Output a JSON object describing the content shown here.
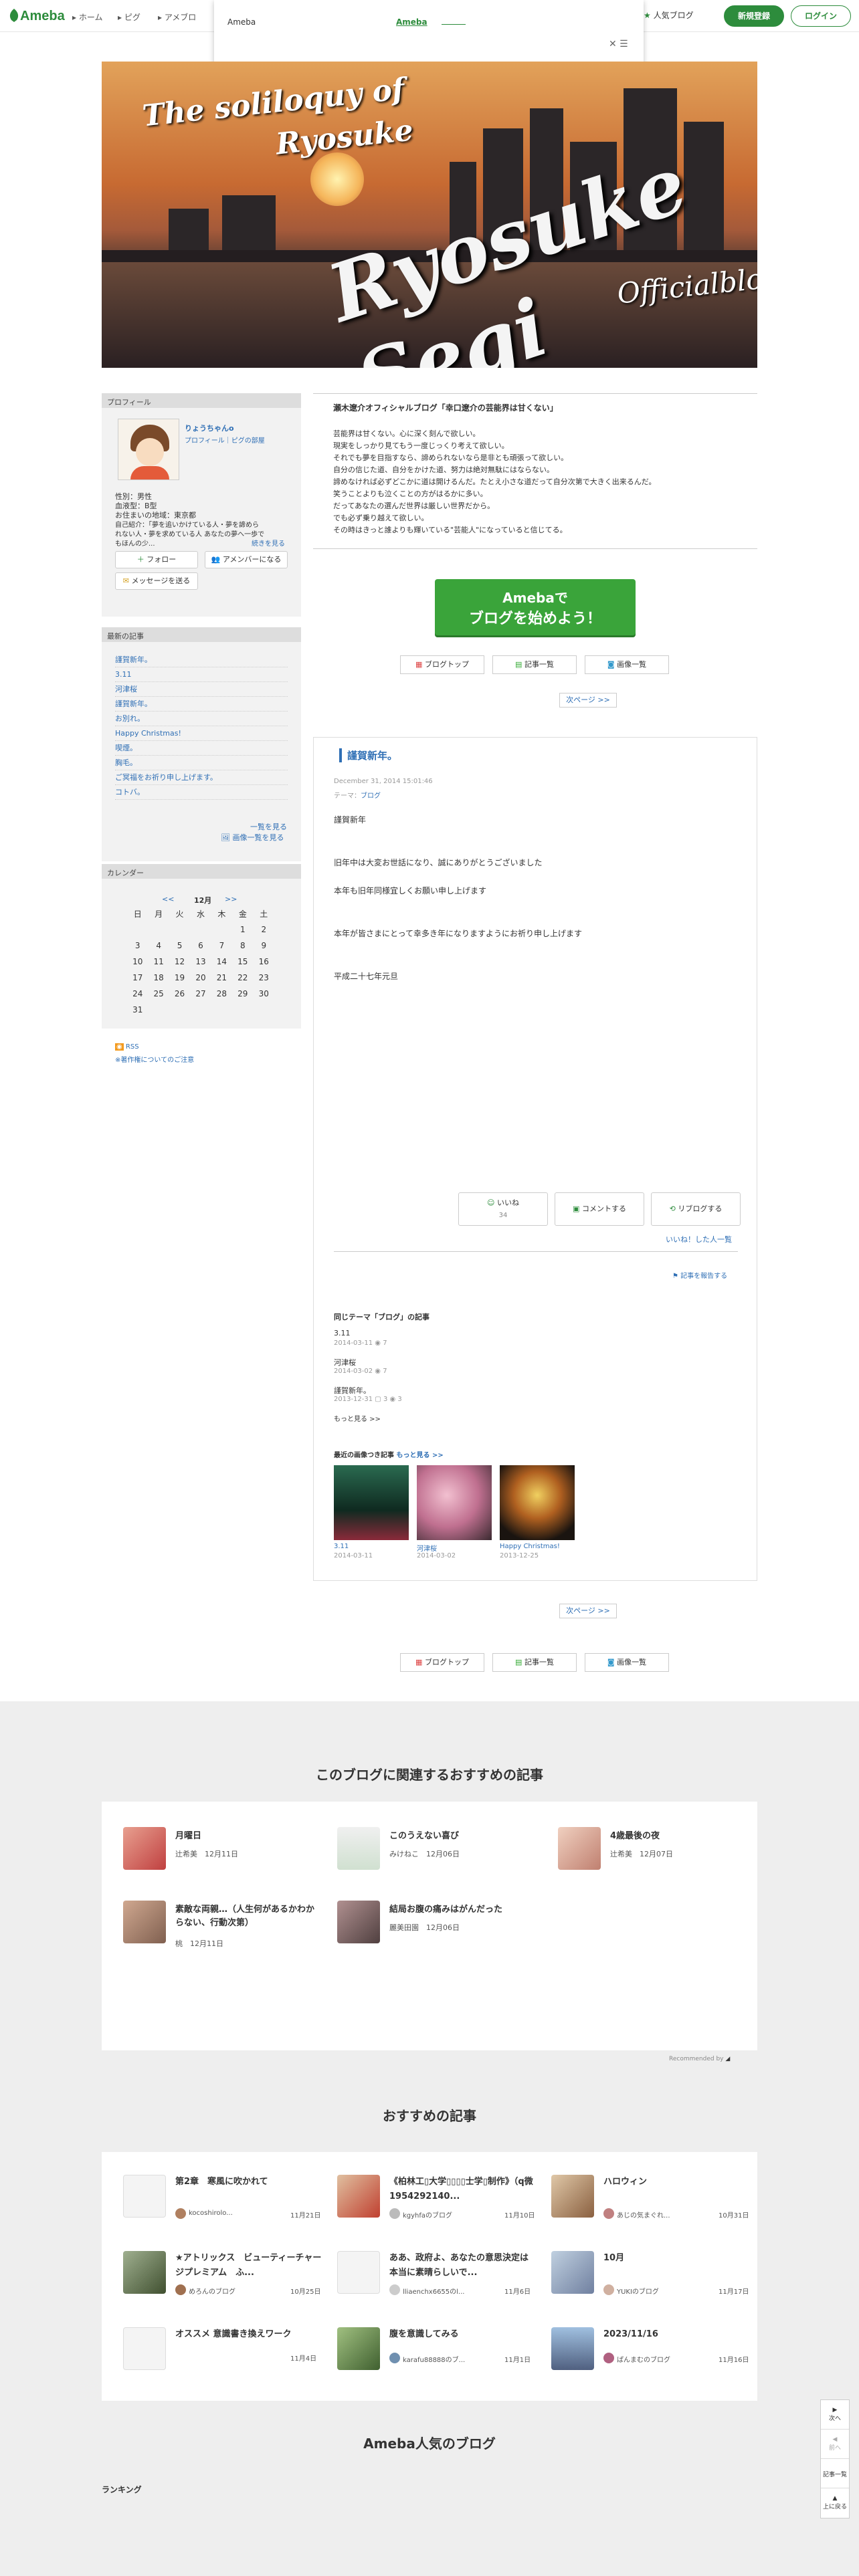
{
  "header": {
    "logo": "Ameba",
    "nav": [
      "ホーム",
      "ピグ",
      "アメブロ"
    ],
    "popup_title": "Ameba",
    "popup_link": "Ameba",
    "popular": "人気ブログ",
    "signup": "新規登録",
    "login": "ログイン"
  },
  "banner": {
    "line1": "The soliloquy of",
    "line2": "Ryosuke",
    "line3": "Ryosuke Segi",
    "line4": "Officialblog"
  },
  "profile": {
    "heading": "プロフィール",
    "name": "りょうちゃんo",
    "links": "プロフィール｜ピグの部屋",
    "gender": "性別：男性",
    "blood": "血液型：B型",
    "home": "お住まいの地域：東京都",
    "bio1": "自己紹介：「夢を追いかけている人・夢を諦めら",
    "bio2": "れない人・夢を求めている人 あなたの夢へ一歩で",
    "bio3": "もほんの少...",
    "more": "続きを見る",
    "follow": "フォロー",
    "member": "アメンバーになる",
    "message": "メッセージを送る"
  },
  "recent": {
    "heading": "最新の記事",
    "items": [
      "謹賀新年。",
      "3.11",
      "河津桜",
      "謹賀新年。",
      "お別れ。",
      "Happy Christmas!",
      "喫煙。",
      "胸毛。",
      "ご冥福をお祈り申し上げます。",
      "コトバ。"
    ],
    "list_link": "一覧を見る",
    "image_link": "画像一覧を見る"
  },
  "calendar": {
    "heading": "カレンダー",
    "prev": "<<",
    "month": "12月",
    "next": ">>",
    "weekdays": [
      "日",
      "月",
      "火",
      "水",
      "木",
      "金",
      "土"
    ],
    "rows": [
      [
        "",
        "",
        "",
        "",
        "",
        "1",
        "2"
      ],
      [
        "3",
        "4",
        "5",
        "6",
        "7",
        "8",
        "9"
      ],
      [
        "10",
        "11",
        "12",
        "13",
        "14",
        "15",
        "16"
      ],
      [
        "17",
        "18",
        "19",
        "20",
        "21",
        "22",
        "23"
      ],
      [
        "24",
        "25",
        "26",
        "27",
        "28",
        "29",
        "30"
      ],
      [
        "31",
        "",
        "",
        "",
        "",
        "",
        ""
      ]
    ]
  },
  "rss": "RSS",
  "copyright_note": "※著作権についてのご注意",
  "intro": {
    "title": "瀬木遼介オフィシャルブログ「幸口遼介の芸能界は甘くない」",
    "lines": [
      "芸能界は甘くない。心に深く刻んで欲しい。",
      "現実をしっかり見てもう一度じっくり考えて欲しい。",
      "それでも夢を目指すなら、諦められないなら是非とも頑張って欲しい。",
      "自分の信じた道、自分をかけた道、努力は絶対無駄にはならない。",
      "諦めなければ必ずどこかに道は開けるんだ。たとえ小さな道だって自分次第で大きく出来るんだ。",
      "笑うことよりも泣くことの方がはるかに多い。",
      "だってあなたの選んだ世界は厳しい世界だから。",
      "でも必ず乗り越えて欲しい。",
      "その時はきっと誰よりも輝いている\"芸能人\"になっていると信じてる。"
    ]
  },
  "cta": {
    "line1": "Amebaで",
    "line2": "ブログを始めよう！"
  },
  "nav_buttons": {
    "top": "ブログトップ",
    "list": "記事一覧",
    "images": "画像一覧",
    "next": "次ページ >>"
  },
  "entry": {
    "title": "謹賀新年。",
    "date": "December 31, 2014 15:01:46",
    "theme_label": "テーマ：",
    "theme": "ブログ",
    "lines": [
      "謹賀新年",
      "旧年中は大変お世話になり、誠にありがとうございました",
      "本年も旧年同様宜しくお願い申し上げます",
      "本年が皆さまにとって幸多き年になりますようにお祈り申し上げます",
      "平成二十七年元旦"
    ],
    "like": "いいね",
    "like_count": "34",
    "comment": "コメントする",
    "reblog": "リブログする",
    "liked_link": "いいね！した人一覧",
    "report": "記事を報告する",
    "same_theme": "同じテーマ「ブログ」の記事",
    "related": [
      {
        "title": "3.11",
        "date": "2014-03-11",
        "c1": "7",
        "c2": ""
      },
      {
        "title": "河津桜",
        "date": "2014-03-02",
        "c1": "7",
        "c2": ""
      },
      {
        "title": "謹賀新年。",
        "date": "2013-12-31",
        "c1": "3",
        "c2": "3"
      }
    ],
    "more": "もっと見る >>",
    "recent_images": "最近の画像つき記事",
    "recent_images_more": "もっと見る >>",
    "thumbs": [
      {
        "title": "3.11",
        "date": "2014-03-11"
      },
      {
        "title": "河津桜",
        "date": "2014-03-02"
      },
      {
        "title": "Happy Christmas!",
        "date": "2013-12-25"
      }
    ]
  },
  "recommend1": {
    "heading": "このブログに関連するおすすめの記事",
    "items": [
      {
        "title": "月曜日",
        "author": "辻希美",
        "date": "12月11日"
      },
      {
        "title": "このうえない喜び",
        "author": "みけねこ",
        "date": "12月06日"
      },
      {
        "title": "4歳最後の夜",
        "author": "辻希美",
        "date": "12月07日"
      },
      {
        "title": "素敵な両親…（人生何があるかわからない、行動次第）",
        "author": "桃",
        "date": "12月11日"
      },
      {
        "title": "結局お腹の痛みはがんだった",
        "author": "麗美田園",
        "date": "12月06日"
      }
    ],
    "credit": "Recommended by"
  },
  "recommend2": {
    "heading": "おすすめの記事",
    "items": [
      {
        "title": "第2章　寒風に吹かれて",
        "author": "kocoshirolo...",
        "date": "11月21日"
      },
      {
        "title": "《柏林工▯大学▯▯▯▯士学▯制作》（q微1954292140...",
        "author": "kgyhfaのブログ",
        "date": "11月10日"
      },
      {
        "title": "ハロウィン",
        "author": "あじの気まぐれ...",
        "date": "10月31日"
      },
      {
        "title": "★アトリックス　ビューティーチャージプレミアム　ふ...",
        "author": "めろんのブログ",
        "date": "10月25日"
      },
      {
        "title": "ああ、政府よ、あなたの意思決定は本当に素晴らしいで...",
        "author": "lliaenchx6655のl...",
        "date": "11月6日"
      },
      {
        "title": "10月",
        "author": "YUKIのブログ",
        "date": "11月17日"
      },
      {
        "title": "オススメ 意識書き換えワーク",
        "author": "",
        "date": "11月4日"
      },
      {
        "title": "腹を意識してみる",
        "author": "karafu88888のブ...",
        "date": "11月1日"
      },
      {
        "title": "2023/11/16",
        "author": "ぱんまむのブログ",
        "date": "11月16日"
      }
    ]
  },
  "popular_heading": "Ameba人気のブログ",
  "ranking": "ランキング",
  "sidefloat": {
    "next": "次へ",
    "prev": "前へ",
    "list": "記事一覧",
    "top": "上に戻る"
  }
}
